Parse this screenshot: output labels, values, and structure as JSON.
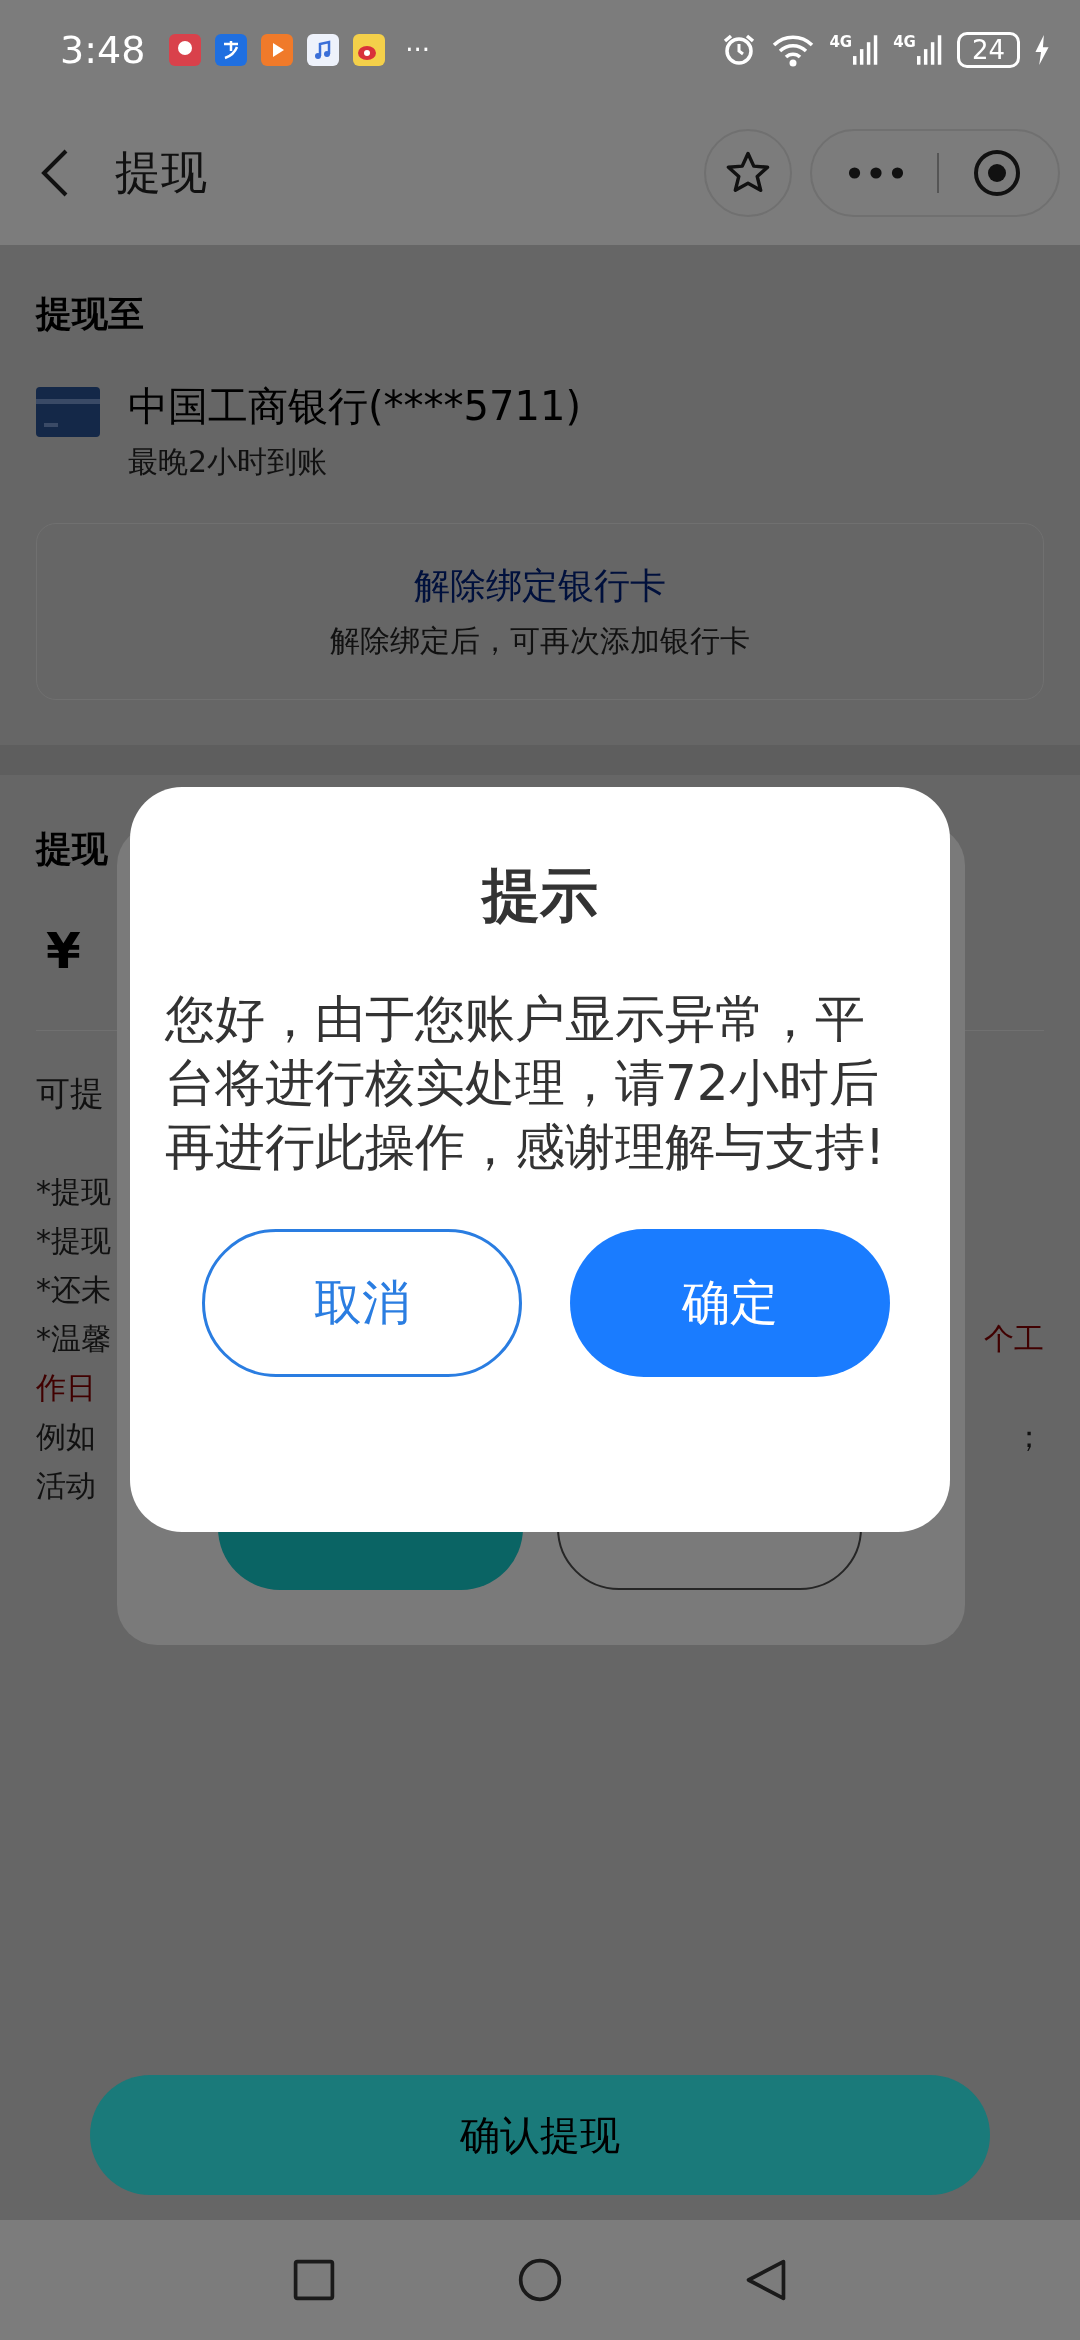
{
  "status_bar": {
    "time": "3:48",
    "more": "···",
    "signals": [
      {
        "label": "4G"
      },
      {
        "label": "4G"
      }
    ],
    "battery": "24"
  },
  "header": {
    "title": "提现"
  },
  "payout": {
    "title": "提现至",
    "bank": "中国工商银行(****5711)",
    "eta": "最晚2小时到账",
    "unbind": {
      "title": "解除绑定银行卡",
      "hint": "解除绑定后，可再次添加银行卡"
    }
  },
  "amount": {
    "title": "提现",
    "currency": "¥",
    "available": "可提"
  },
  "notes": [
    {
      "left": {
        "text": "*提现",
        "kind": "normal"
      }
    },
    {
      "left": {
        "text": "*提现",
        "kind": "normal"
      }
    },
    {
      "left": {
        "text": "*还未",
        "kind": "normal"
      }
    },
    {
      "left": {
        "text": "*温馨",
        "kind": "normal"
      },
      "right": {
        "text": "个工",
        "kind": "warning"
      }
    },
    {
      "left": {
        "text": "作日",
        "kind": "warning"
      }
    },
    {
      "left": {
        "text": "例如",
        "kind": "normal"
      },
      "right": {
        "text": "；",
        "kind": "normal"
      }
    },
    {
      "left": {
        "text": "活动",
        "kind": "normal"
      }
    }
  ],
  "back_dialog": {
    "buttons": [
      {
        "kind": "primary"
      },
      {
        "kind": "outline"
      }
    ]
  },
  "dialog": {
    "title": "提示",
    "message": "您好，由于您账户显示异常，平台将进行核实处理，请72小时后再进行此操作，感谢理解与支持!",
    "buttons": [
      {
        "label": "取消",
        "kind": "outline"
      },
      {
        "label": "确定",
        "kind": "primary"
      }
    ]
  },
  "footer": {
    "button": "确认提现"
  }
}
